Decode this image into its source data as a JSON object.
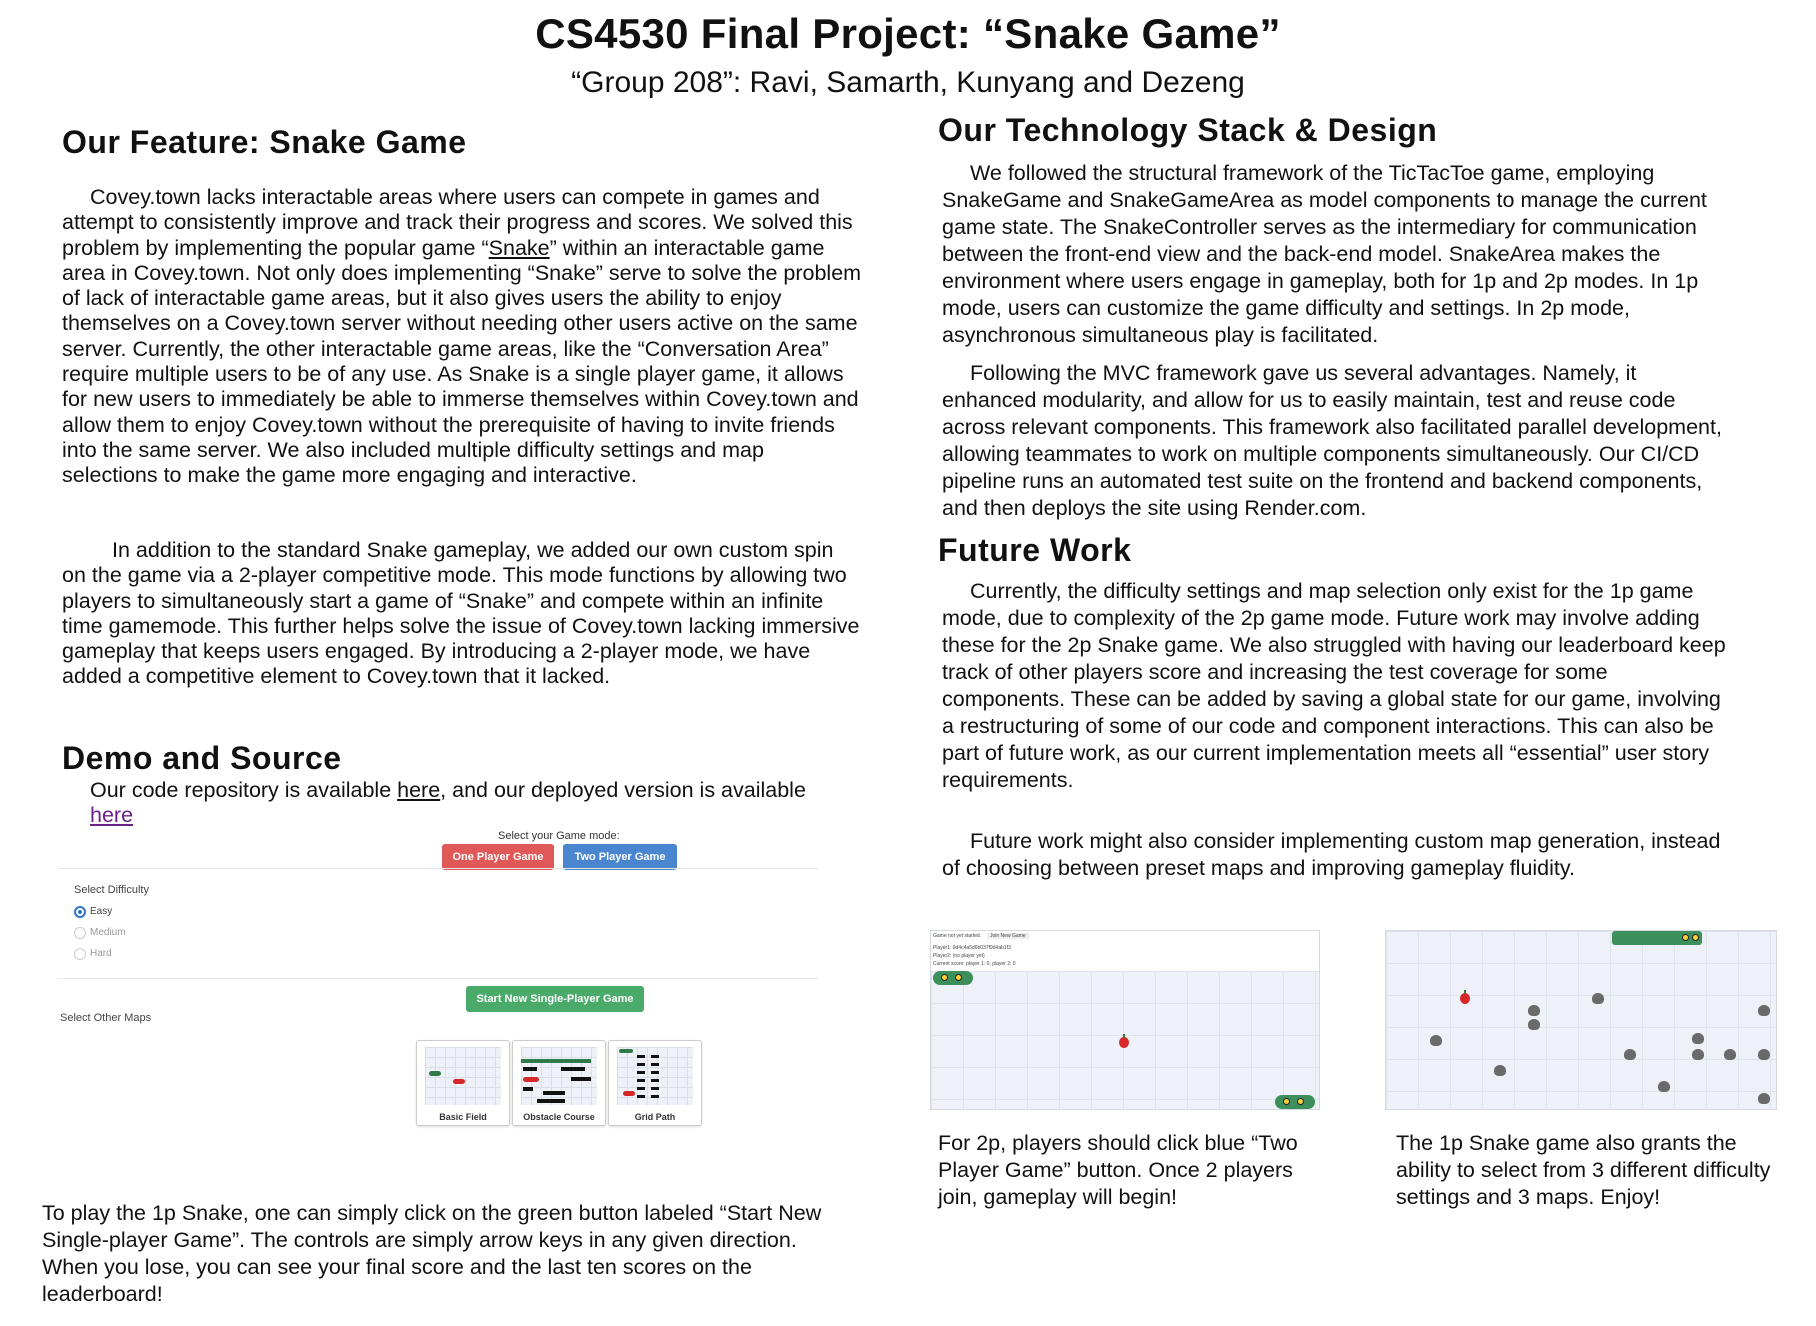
{
  "header": {
    "title": "CS4530 Final Project: “Snake Game”",
    "subtitle": "“Group 208”: Ravi, Samarth, Kunyang and Dezeng"
  },
  "feature": {
    "heading": "Our Feature: Snake Game",
    "p1": "Covey.town lacks interactable areas where users can compete in games and attempt to consistently improve and track their progress and scores. We solved this problem by implementing the popular game “",
    "p1_link": "Snake",
    "p1_rest": "” within an interactable game area in Covey.town. Not only does implementing “Snake” serve to solve the problem of lack of interactable game areas, but it also gives users the ability to enjoy themselves on a Covey.town server without needing other users active on the same server. Currently, the other interactable game areas, like the “Conversation Area” require multiple users to be of any use. As Snake is a single player game, it allows for new users to immediately be able to immerse themselves within Covey.town and allow them to enjoy Covey.town without the prerequisite of having to invite friends into the same server. We also included multiple difficulty settings and map selections to make the game more engaging and interactive.",
    "p2": "In addition to the standard Snake gameplay, we added our own custom spin on the game via a 2-player competitive mode. This mode functions by allowing two players to simultaneously start a game of “Snake” and compete within an infinite time gamemode. This further helps solve the issue of Covey.town lacking immersive gameplay that keeps users engaged. By introducing a 2-player mode, we have added a competitive element to Covey.town that it lacked."
  },
  "demo": {
    "heading": "Demo and Source",
    "text_a": "Our code repository is available ",
    "link1": "here",
    "text_b": ", and our deployed version is available",
    "link2": "here"
  },
  "mock_ui": {
    "mode_label": "Select your Game mode:",
    "btn_one": "One Player Game",
    "btn_two": "Two Player Game",
    "difficulty_label": "Select Difficulty",
    "difficulties": [
      "Easy",
      "Medium",
      "Hard"
    ],
    "selected_difficulty": "Easy",
    "start_btn": "Start New Single-Player Game",
    "maps_label": "Select Other Maps",
    "maps": [
      "Basic Field",
      "Obstacle Course",
      "Grid Path"
    ],
    "colors": {
      "red": "#e05858",
      "blue": "#4a86d0",
      "green": "#4aaa6a"
    }
  },
  "bottom_left": "To play the 1p Snake, one can simply click on the green button labeled “Start New Single-player Game”. The controls are simply arrow keys in any given direction. When you lose, you can see your final score and the last ten scores on the leaderboard!",
  "tech": {
    "heading": "Our Technology Stack & Design",
    "p1": "We followed the structural framework of the TicTacToe game, employing SnakeGame and SnakeGameArea as model components to manage the current game state. The SnakeController serves as the intermediary for communication between the front-end view and the back-end model. SnakeArea makes the environment where users engage in gameplay, both for 1p and 2p modes. In 1p mode, users can customize the game difficulty and settings. In 2p mode, asynchronous simultaneous play is facilitated.",
    "p2": "Following the MVC framework gave us several advantages. Namely, it enhanced modularity, and allow for us to easily maintain, test and reuse code across relevant components. This framework also facilitated parallel development, allowing teammates to work on multiple components simultaneously. Our CI/CD pipeline runs an automated test suite on the frontend and backend components, and then deploys the site using Render.com."
  },
  "future": {
    "heading": "Future Work",
    "p1": "Currently, the difficulty settings and map selection only exist for the 1p game mode, due to complexity of the 2p game mode. Future work may involve adding these for the 2p Snake game. We also struggled with having our leaderboard keep track of other players score and increasing the test coverage for some components. These can be added by saving a global state for our game, involving a restructuring of some of our code and component interactions. This can also be part of future work, as our current implementation meets all “essential” user story requirements.",
    "p2": "Future work might also consider implementing custom map generation, instead of choosing between preset maps and improving gameplay fluidity."
  },
  "shot_2p": {
    "status": "Game not yet started.",
    "button": "Join New Game",
    "player1": "Player1: 9d4c4a5d6b037f9d4ab1f3",
    "player2": "Player2: (no player yet)",
    "score": "Current score: player 1: 0, player 2: 0"
  },
  "captions": {
    "left": "For 2p, players should click blue “Two Player Game” button. Once 2 players join, gameplay will begin!",
    "right": "The 1p Snake game also grants the ability to select from 3 different difficulty settings and 3 maps. Enjoy!"
  }
}
